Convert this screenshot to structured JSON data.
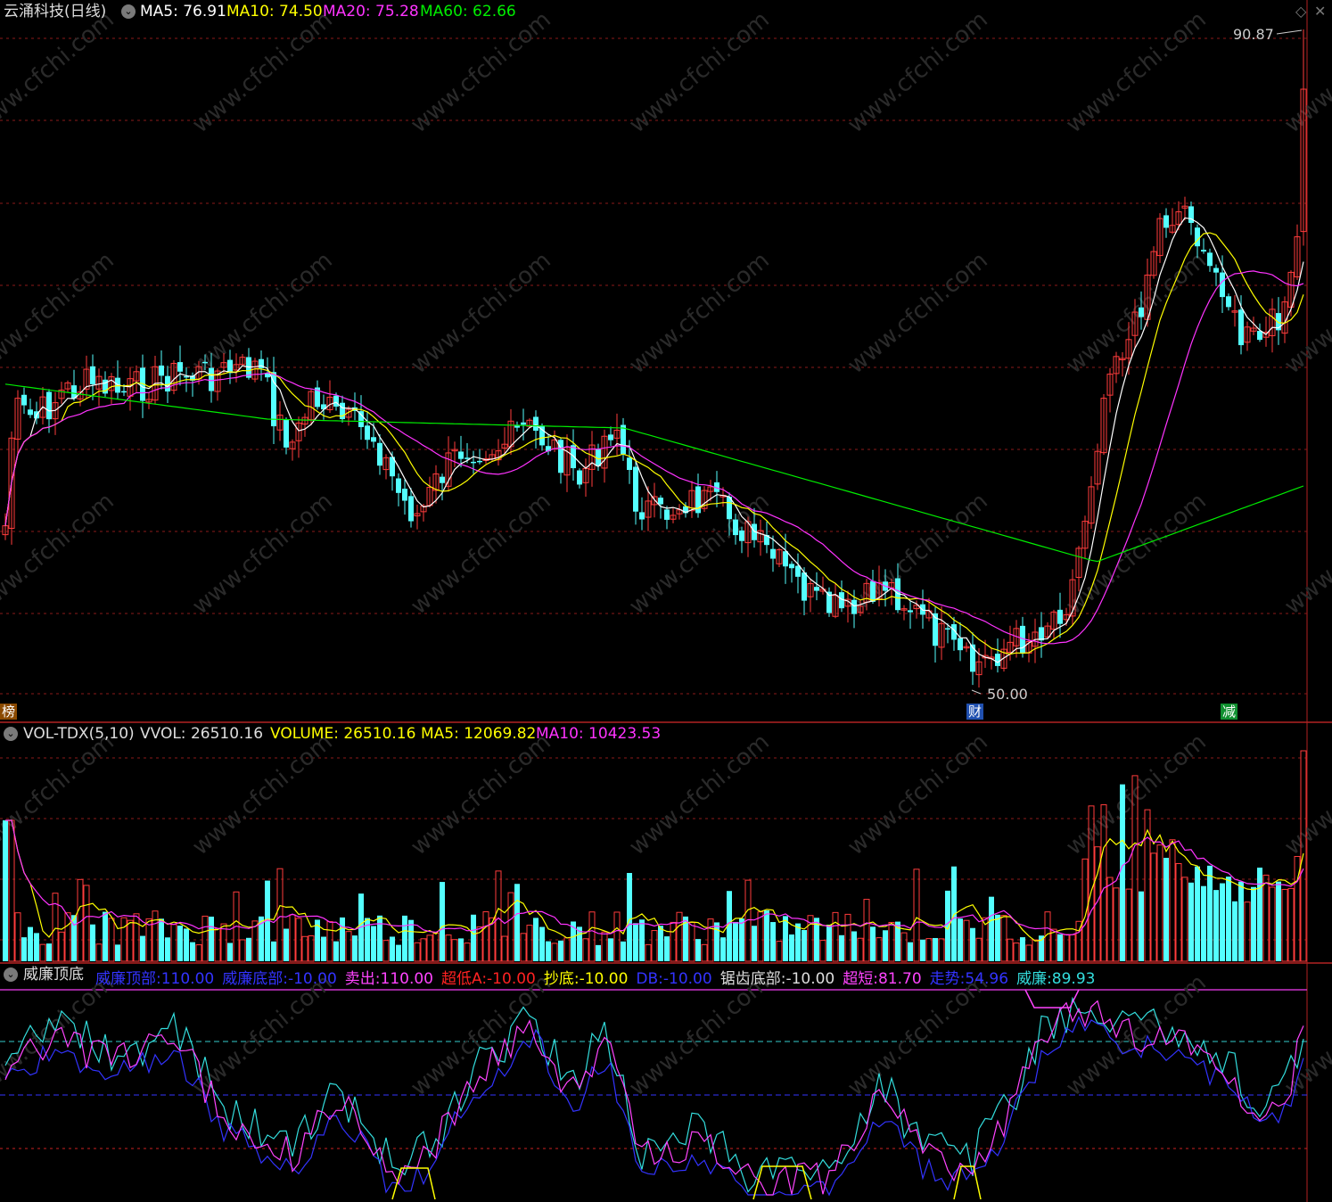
{
  "main": {
    "title": "云涌科技(日线)",
    "indicators": [
      {
        "label": "MA5: 76.91",
        "color": "#ffffff"
      },
      {
        "label": "MA10: 74.50",
        "color": "#ffff00"
      },
      {
        "label": "MA20: 75.28",
        "color": "#ff33ff"
      },
      {
        "label": "MA60: 62.66",
        "color": "#00ee00"
      }
    ],
    "high_label": "90.87",
    "low_label": "50.00",
    "marker_left": "榜",
    "marker_cai": "财",
    "marker_jian": "减"
  },
  "volume": {
    "indicator_name": "VOL-TDX(5,10)",
    "vvol": "VVOL: 26510.16",
    "volume": "VOLUME: 26510.16",
    "ma5": "MA5: 12069.82",
    "ma10": "MA10: 10423.53"
  },
  "osc": {
    "name": "威廉顶底",
    "items": [
      {
        "label": "威廉顶部:",
        "value": "110.00",
        "color": "#3333ff"
      },
      {
        "label": "威廉底部:",
        "value": "-10.00",
        "color": "#3333ff"
      },
      {
        "label": "卖出:",
        "value": "110.00",
        "color": "#ff44ff"
      },
      {
        "label": "超低A:",
        "value": "-10.00",
        "color": "#ff2222"
      },
      {
        "label": "抄底:",
        "value": "-10.00",
        "color": "#ffff00"
      },
      {
        "label": "DB:",
        "value": "-10.00",
        "color": "#3333ff"
      },
      {
        "label": "锯齿底部:",
        "value": "-10.00",
        "color": "#dddddd"
      },
      {
        "label": "超短:",
        "value": "81.70",
        "color": "#ff44ff"
      },
      {
        "label": "走势:",
        "value": "54.96",
        "color": "#3333ff"
      },
      {
        "label": "威廉:",
        "value": "89.93",
        "color": "#33dddd"
      }
    ]
  },
  "watermark": "www.cfchi.com",
  "colors": {
    "up": "#ff3c3c",
    "down": "#54ffff",
    "grid": "#8b1a1a"
  }
}
